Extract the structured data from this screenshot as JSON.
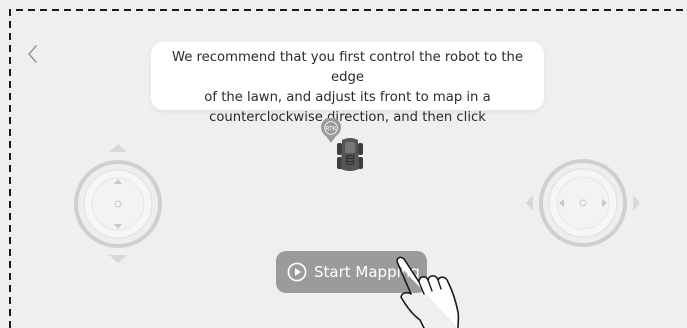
{
  "tip": {
    "line1": "We recommend that you first control the robot to the edge",
    "line2": "of the lawn, and adjust its front to map in a",
    "line3": "counterclockwise direction, and then click"
  },
  "badge": {
    "label": "RTK"
  },
  "start_button": {
    "label": "Start Mapping"
  },
  "icons": {
    "back": "chevron-left-icon",
    "badge": "rtk-pin-icon",
    "robot": "robot-mower-icon",
    "play": "play-circle-icon",
    "hand": "pointing-hand-icon"
  },
  "colors": {
    "background": "#efefef",
    "button": "#9b9b9b",
    "text": "#2b2b2b"
  }
}
